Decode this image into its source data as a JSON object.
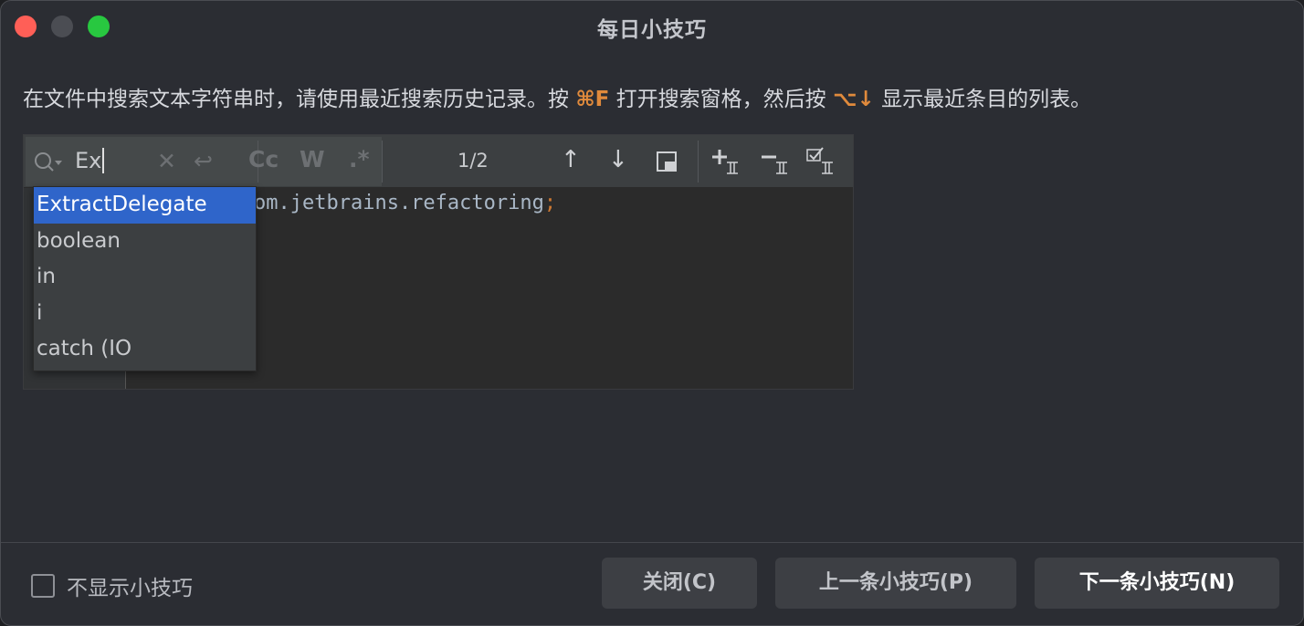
{
  "window": {
    "title": "每日小技巧"
  },
  "tip": {
    "part1": "在文件中搜索文本字符串时，请使用最近搜索历史记录。按 ",
    "shortcut1": "⌘F",
    "part2": " 打开搜索窗格，然后按 ",
    "shortcut2": "⌥↓",
    "part3": " 显示最近条目的列表。"
  },
  "find_bar": {
    "search_value": "Ex",
    "match_count": "1/2",
    "case_label": "Cc",
    "word_label": "W",
    "regex_label": ".*"
  },
  "editor": {
    "code_visible": "om.jetbrains.refactoring",
    "code_semicolon": ";"
  },
  "history_dropdown": {
    "items": [
      "ExtractDelegate",
      "boolean",
      "in",
      "i",
      "catch (IO"
    ],
    "selected_index": 0
  },
  "footer": {
    "checkbox_label": "不显示小技巧",
    "checkbox_checked": false,
    "close_label": "关闭(C)",
    "prev_label": "上一条小技巧(P)",
    "next_label": "下一条小技巧(N)"
  },
  "colors": {
    "shortcut": "#e08a3c",
    "selection": "#2f65ca",
    "close_button": "#ff5f57",
    "maximize_button": "#28c840"
  }
}
